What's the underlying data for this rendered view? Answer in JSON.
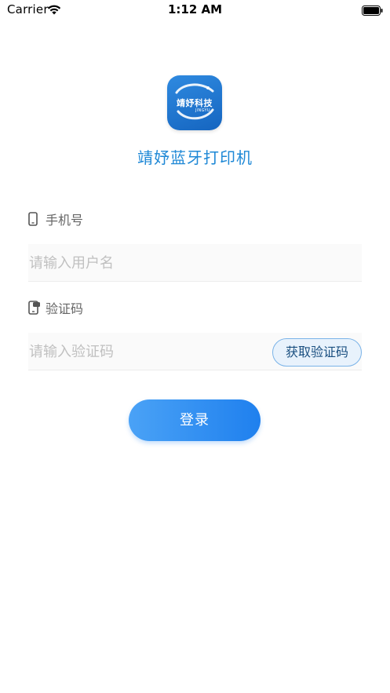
{
  "status_bar": {
    "carrier": "Carrier",
    "time": "1:12 AM",
    "wifi_icon": "wifi-icon",
    "battery_icon": "battery-full-icon"
  },
  "logo": {
    "text": "靖妤科技",
    "sub_text": "JINGYU",
    "colors": {
      "top": "#2f8ae0",
      "bottom": "#1565c0"
    }
  },
  "app": {
    "title": "靖妤蓝牙打印机",
    "title_color": "#1e88d6"
  },
  "form": {
    "phone": {
      "label": "手机号",
      "icon": "phone-icon",
      "placeholder": "请输入用户名",
      "value": ""
    },
    "code": {
      "label": "验证码",
      "icon": "message-phone-icon",
      "placeholder": "请输入验证码",
      "value": "",
      "get_code_label": "获取验证码"
    },
    "login_label": "登录",
    "accent": "#1f80ee"
  }
}
